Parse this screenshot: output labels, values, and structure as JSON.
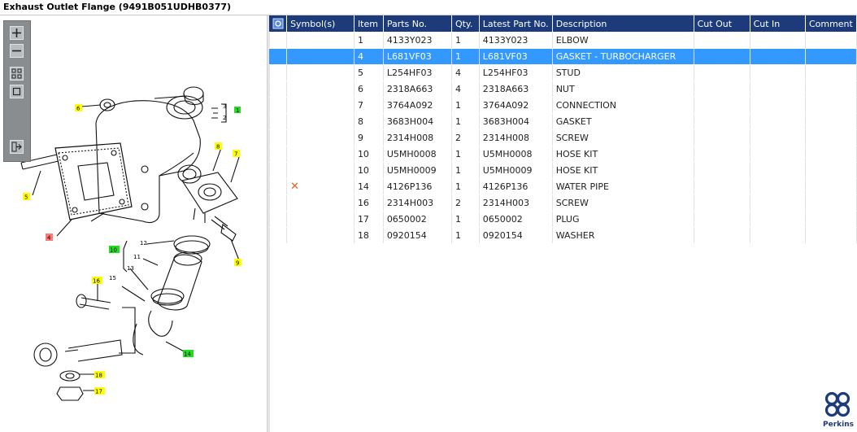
{
  "title": "Exhaust Outlet Flange (9491B051UDHB0377)",
  "toolbar": {
    "buttons": [
      "zoom-in",
      "zoom-out",
      "fit-all",
      "fit-window",
      "export"
    ]
  },
  "diagram": {
    "callouts": [
      "1",
      "2",
      "3",
      "4",
      "5",
      "6",
      "7",
      "8",
      "9",
      "10",
      "11",
      "12",
      "13",
      "14",
      "15",
      "16",
      "17",
      "18"
    ]
  },
  "table": {
    "columns": [
      "Symbol(s)",
      "Item",
      "Parts No.",
      "Qty.",
      "Latest Part No.",
      "Description",
      "Cut Out",
      "Cut In",
      "Comment"
    ],
    "rows": [
      {
        "symbol": "",
        "item": "1",
        "part": "4133Y023",
        "qty": "1",
        "latest": "4133Y023",
        "desc": "ELBOW"
      },
      {
        "symbol": "",
        "item": "4",
        "part": "L681VF03",
        "qty": "1",
        "latest": "L681VF03",
        "desc": "GASKET - TURBOCHARGER"
      },
      {
        "symbol": "",
        "item": "5",
        "part": "L254HF03",
        "qty": "4",
        "latest": "L254HF03",
        "desc": "STUD"
      },
      {
        "symbol": "",
        "item": "6",
        "part": "2318A663",
        "qty": "4",
        "latest": "2318A663",
        "desc": "NUT"
      },
      {
        "symbol": "",
        "item": "7",
        "part": "3764A092",
        "qty": "1",
        "latest": "3764A092",
        "desc": "CONNECTION"
      },
      {
        "symbol": "",
        "item": "8",
        "part": "3683H004",
        "qty": "1",
        "latest": "3683H004",
        "desc": "GASKET"
      },
      {
        "symbol": "",
        "item": "9",
        "part": "2314H008",
        "qty": "2",
        "latest": "2314H008",
        "desc": "SCREW"
      },
      {
        "symbol": "",
        "item": "10",
        "part": "U5MH0008",
        "qty": "1",
        "latest": "U5MH0008",
        "desc": "HOSE KIT"
      },
      {
        "symbol": "",
        "item": "10",
        "part": "U5MH0009",
        "qty": "1",
        "latest": "U5MH0009",
        "desc": "HOSE KIT"
      },
      {
        "symbol": "✕",
        "item": "14",
        "part": "4126P136",
        "qty": "1",
        "latest": "4126P136",
        "desc": "WATER PIPE"
      },
      {
        "symbol": "",
        "item": "16",
        "part": "2314H003",
        "qty": "2",
        "latest": "2314H003",
        "desc": "SCREW"
      },
      {
        "symbol": "",
        "item": "17",
        "part": "0650002",
        "qty": "1",
        "latest": "0650002",
        "desc": "PLUG"
      },
      {
        "symbol": "",
        "item": "18",
        "part": "0920154",
        "qty": "1",
        "latest": "0920154",
        "desc": "WASHER"
      }
    ],
    "selected_row_index": 1
  },
  "brand": {
    "name": "Perkins",
    "color": "#1d3b7a"
  },
  "colors": {
    "header_bg": "#1d3b7a",
    "selected_bg": "#3399ff",
    "callout_yellow": "#ffff00",
    "callout_green": "#22dd22",
    "callout_red": "#ff7777"
  }
}
